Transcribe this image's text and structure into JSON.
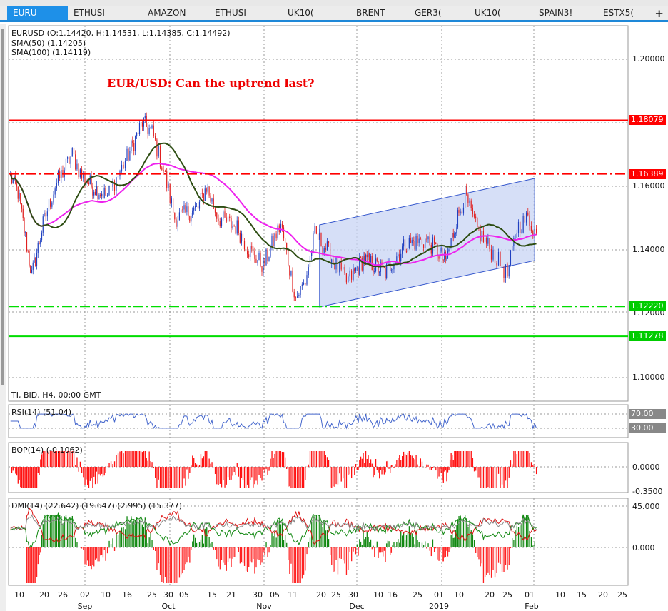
{
  "tabs": [
    "EURU",
    "ETHUSI",
    "AMAZON",
    "ETHUSI",
    "UK10(",
    "BRENT",
    "GER3(",
    "UK10(",
    "SPAIN3!",
    "ESTX5("
  ],
  "add_tab": "+",
  "legend": {
    "ohlc": "EURUSD (O:1.14420, H:1.14531, L:1.14385, C:1.14492)",
    "sma50": "SMA(50) (1.14205)",
    "sma100": "SMA(100) (1.14119)"
  },
  "headline": "EUR/USD: Can the uptrend last?",
  "footer_info": "TI, BID, H4, 00:00 GMT",
  "price_axis": [
    "1.20000",
    "1.16000",
    "1.14000",
    "1.12000",
    "1.10000"
  ],
  "levels": [
    {
      "label": "1.18079",
      "price": 1.18079,
      "color": "#ff0000",
      "style": "solid"
    },
    {
      "label": "1.16389",
      "price": 1.16389,
      "color": "#ff0000",
      "style": "dashdot"
    },
    {
      "label": "1.12220",
      "price": 1.1222,
      "color": "#00dd00",
      "style": "dashdot"
    },
    {
      "label": "1.11278",
      "price": 1.11278,
      "color": "#00dd00",
      "style": "solid"
    }
  ],
  "indicators": {
    "rsi": "RSI(14) (51.04)",
    "rsi_levels": [
      "70.00",
      "30.00"
    ],
    "bop": "BOP(14) (-0.1062)",
    "bop_levels": [
      "0.0000",
      "-0.3500"
    ],
    "dmi": "DMI(14) (22.642) (19.647) (2.995) (15.377)",
    "dmi_levels": [
      "45.000",
      "0.000"
    ]
  },
  "x_ticks": [
    "10",
    "20",
    "26",
    "02",
    "10",
    "16",
    "25",
    "30",
    "05",
    "15",
    "21",
    "30",
    "05",
    "11",
    "20",
    "25",
    "30",
    "10",
    "16",
    "25",
    "01",
    "10",
    "20",
    "25",
    "01",
    "10",
    "15",
    "20",
    "25"
  ],
  "x_months": [
    "Sep",
    "Oct",
    "Nov",
    "Dec",
    "2019",
    "Feb"
  ],
  "colors": {
    "sma50": "#2d4d12",
    "sma100": "#ee22ee",
    "bull": "#2040c0",
    "bear": "#e02020",
    "channel": "#c8d4f4"
  },
  "chart_data": {
    "type": "line",
    "symbol": "EURUSD",
    "timeframe": "H4",
    "ylim": [
      1.09236,
      1.21056
    ],
    "x_tick_days": [
      10,
      20,
      26,
      33,
      41,
      47,
      56,
      61,
      66,
      76,
      82,
      91,
      97,
      103,
      112,
      117,
      122,
      132,
      138,
      147,
      154,
      163,
      173,
      178,
      185,
      194,
      199,
      204,
      209
    ],
    "price_path": [
      [
        6.5,
        1.163
      ],
      [
        9.5,
        1.158
      ],
      [
        15,
        1.132
      ],
      [
        19.5,
        1.148
      ],
      [
        23.5,
        1.16
      ],
      [
        29,
        1.17
      ],
      [
        32,
        1.163
      ],
      [
        36,
        1.16
      ],
      [
        41.5,
        1.157
      ],
      [
        46.5,
        1.168
      ],
      [
        52.5,
        1.18
      ],
      [
        56,
        1.177
      ],
      [
        59.5,
        1.165
      ],
      [
        63,
        1.15
      ],
      [
        71,
        1.153
      ],
      [
        74,
        1.16
      ],
      [
        78,
        1.15
      ],
      [
        84,
        1.147
      ],
      [
        88,
        1.14
      ],
      [
        93,
        1.135
      ],
      [
        99,
        1.148
      ],
      [
        104,
        1.125
      ],
      [
        107,
        1.13
      ],
      [
        110,
        1.145
      ],
      [
        114,
        1.14
      ],
      [
        120,
        1.13
      ],
      [
        126,
        1.137
      ],
      [
        135,
        1.133
      ],
      [
        143,
        1.142
      ],
      [
        150,
        1.143
      ],
      [
        157,
        1.136
      ],
      [
        165,
        1.157
      ],
      [
        168.5,
        1.147
      ],
      [
        174,
        1.139
      ],
      [
        178,
        1.132
      ],
      [
        181,
        1.147
      ],
      [
        184.5,
        1.15
      ],
      [
        187,
        1.145
      ]
    ],
    "channel": {
      "upper": [
        [
          111.5,
          1.14787
        ],
        [
          186.5,
          1.16247
        ]
      ],
      "lower": [
        [
          111.5,
          1.12202
        ],
        [
          186.5,
          1.13663
        ]
      ]
    }
  }
}
